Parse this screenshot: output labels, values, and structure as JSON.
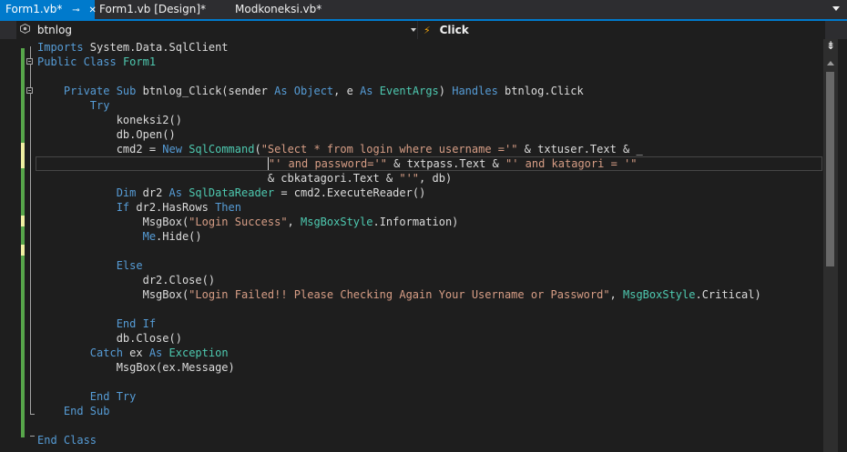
{
  "tabs": [
    {
      "label": "Form1.vb*",
      "pin_icon": "⊸",
      "close_icon": "✕",
      "active": true
    },
    {
      "label": "Form1.vb [Design]*",
      "active": false
    },
    {
      "label": "Modkoneksi.vb*",
      "active": false
    }
  ],
  "nav": {
    "left_value": "btnlog",
    "left_icon": "class-member-icon",
    "right_value": "Click",
    "right_icon": "event-lightning-icon"
  },
  "code_lines": [
    [
      {
        "t": "Imports",
        "c": "kw"
      },
      {
        "t": " System.Data.SqlClient"
      }
    ],
    [
      {
        "t": "Public Class",
        "c": "kw"
      },
      {
        "t": " "
      },
      {
        "t": "Form1",
        "c": "ty"
      }
    ],
    [
      {
        "t": ""
      }
    ],
    [
      {
        "t": "    "
      },
      {
        "t": "Private Sub",
        "c": "kw"
      },
      {
        "t": " btnlog_Click(sender "
      },
      {
        "t": "As",
        "c": "kw"
      },
      {
        "t": " "
      },
      {
        "t": "Object",
        "c": "kw"
      },
      {
        "t": ", e "
      },
      {
        "t": "As",
        "c": "kw"
      },
      {
        "t": " "
      },
      {
        "t": "EventArgs",
        "c": "ty"
      },
      {
        "t": ") "
      },
      {
        "t": "Handles",
        "c": "kw"
      },
      {
        "t": " btnlog.Click"
      }
    ],
    [
      {
        "t": "        "
      },
      {
        "t": "Try",
        "c": "kw"
      }
    ],
    [
      {
        "t": "            koneksi2()"
      }
    ],
    [
      {
        "t": "            db.Open()"
      }
    ],
    [
      {
        "t": "            cmd2 = "
      },
      {
        "t": "New",
        "c": "kw"
      },
      {
        "t": " "
      },
      {
        "t": "SqlCommand",
        "c": "ty"
      },
      {
        "t": "("
      },
      {
        "t": "\"Select * from login where username ='\"",
        "c": "str"
      },
      {
        "t": " & txtuser.Text & _"
      }
    ],
    [
      {
        "t": "                                   "
      },
      {
        "t": "\"' and password='\"",
        "c": "str"
      },
      {
        "t": " & txtpass.Text & "
      },
      {
        "t": "\"' and katagori = '\"",
        "c": "str"
      }
    ],
    [
      {
        "t": "                                   & cbkatagori.Text & "
      },
      {
        "t": "\"'\"",
        "c": "str"
      },
      {
        "t": ", db)"
      }
    ],
    [
      {
        "t": "            "
      },
      {
        "t": "Dim",
        "c": "kw"
      },
      {
        "t": " dr2 "
      },
      {
        "t": "As",
        "c": "kw"
      },
      {
        "t": " "
      },
      {
        "t": "SqlDataReader",
        "c": "ty"
      },
      {
        "t": " = cmd2.ExecuteReader()"
      }
    ],
    [
      {
        "t": "            "
      },
      {
        "t": "If",
        "c": "kw"
      },
      {
        "t": " dr2.HasRows "
      },
      {
        "t": "Then",
        "c": "kw"
      }
    ],
    [
      {
        "t": "                MsgBox("
      },
      {
        "t": "\"Login Success\"",
        "c": "str"
      },
      {
        "t": ", "
      },
      {
        "t": "MsgBoxStyle",
        "c": "ty"
      },
      {
        "t": ".Information)"
      }
    ],
    [
      {
        "t": "                "
      },
      {
        "t": "Me",
        "c": "kw"
      },
      {
        "t": ".Hide()"
      }
    ],
    [
      {
        "t": ""
      }
    ],
    [
      {
        "t": "            "
      },
      {
        "t": "Else",
        "c": "kw"
      }
    ],
    [
      {
        "t": "                dr2.Close()"
      }
    ],
    [
      {
        "t": "                MsgBox("
      },
      {
        "t": "\"Login Failed!! Please Checking Again Your Username or Password\"",
        "c": "str"
      },
      {
        "t": ", "
      },
      {
        "t": "MsgBoxStyle",
        "c": "ty"
      },
      {
        "t": ".Critical)"
      }
    ],
    [
      {
        "t": ""
      }
    ],
    [
      {
        "t": "            "
      },
      {
        "t": "End If",
        "c": "kw"
      }
    ],
    [
      {
        "t": "            db.Close()"
      }
    ],
    [
      {
        "t": "        "
      },
      {
        "t": "Catch",
        "c": "kw"
      },
      {
        "t": " ex "
      },
      {
        "t": "As",
        "c": "kw"
      },
      {
        "t": " "
      },
      {
        "t": "Exception",
        "c": "ty"
      }
    ],
    [
      {
        "t": "            MsgBox(ex.Message)"
      }
    ],
    [
      {
        "t": ""
      }
    ],
    [
      {
        "t": "        "
      },
      {
        "t": "End Try",
        "c": "kw"
      }
    ],
    [
      {
        "t": "    "
      },
      {
        "t": "End Sub",
        "c": "kw"
      }
    ],
    [
      {
        "t": ""
      }
    ],
    [
      {
        "t": "End Class",
        "c": "kw"
      }
    ]
  ],
  "current_line": 8,
  "colors": {
    "keyword": "#569cd6",
    "type": "#4ec9b0",
    "string": "#d69d85",
    "text": "#dcdcdc",
    "background": "#1e1e1e",
    "accent": "#007acc",
    "saved_change": "#57a64a",
    "unsaved_change": "#efefa1"
  }
}
